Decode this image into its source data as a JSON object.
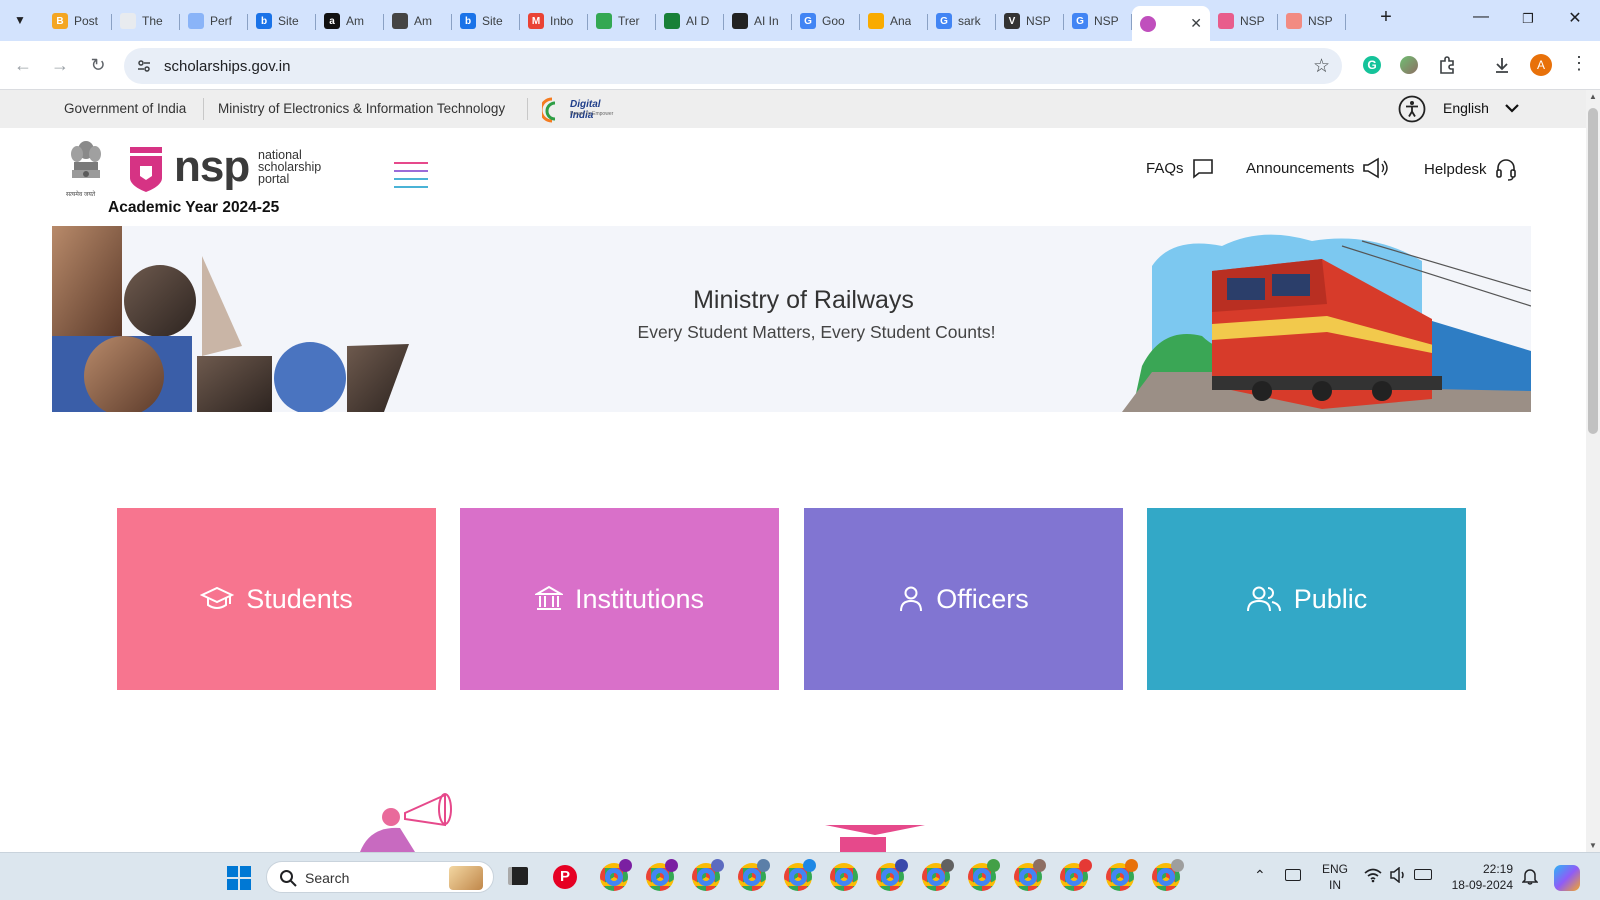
{
  "browser": {
    "tabs": [
      {
        "title": "Post",
        "color": "#f4a623",
        "glyph": "B"
      },
      {
        "title": "The",
        "color": "#e8ebef",
        "glyph": ""
      },
      {
        "title": "Perf",
        "color": "#8ab4f8",
        "glyph": ""
      },
      {
        "title": "Site",
        "color": "#1a73e8",
        "glyph": "b"
      },
      {
        "title": "Am",
        "color": "#111111",
        "glyph": "a"
      },
      {
        "title": "Am",
        "color": "#444444",
        "glyph": ""
      },
      {
        "title": "Site",
        "color": "#1a73e8",
        "glyph": "b"
      },
      {
        "title": "Inbo",
        "color": "#ea4335",
        "glyph": "M"
      },
      {
        "title": "Trer",
        "color": "#34a853",
        "glyph": ""
      },
      {
        "title": "AI D",
        "color": "#188038",
        "glyph": ""
      },
      {
        "title": "AI In",
        "color": "#222222",
        "glyph": ""
      },
      {
        "title": "Goo",
        "color": "#4285f4",
        "glyph": "G"
      },
      {
        "title": "Ana",
        "color": "#f9ab00",
        "glyph": ""
      },
      {
        "title": "sark",
        "color": "#4285f4",
        "glyph": "G"
      },
      {
        "title": "NSP",
        "color": "#333333",
        "glyph": "V"
      },
      {
        "title": "NSP",
        "color": "#4285f4",
        "glyph": "G"
      },
      {
        "title": "",
        "color": "#c04fbd",
        "glyph": "",
        "active": true
      },
      {
        "title": "NSP",
        "color": "#e85d8c",
        "glyph": ""
      },
      {
        "title": "NSP",
        "color": "#f28b82",
        "glyph": ""
      }
    ],
    "url": "scholarships.gov.in",
    "profile_initial": "A"
  },
  "gov_bar": {
    "gov_india": "Government of India",
    "ministry": "Ministry of Electronics & Information Technology",
    "digital_india": "Digital India",
    "digital_india_tag": "Power To Empower",
    "language": "English"
  },
  "header": {
    "logo_text": "nsp",
    "logo_lines": [
      "national",
      "scholarship",
      "portal"
    ],
    "academic_year": "Academic Year 2024-25",
    "emblem_caption": "सत्यमेव जयते",
    "nav": {
      "faqs": "FAQs",
      "announcements": "Announcements",
      "helpdesk": "Helpdesk"
    }
  },
  "banner": {
    "title": "Ministry of Railways",
    "subtitle": "Every Student Matters, Every Student Counts!"
  },
  "tiles": [
    {
      "label": "Students",
      "color": "#f7758f"
    },
    {
      "label": "Institutions",
      "color": "#d970c9"
    },
    {
      "label": "Officers",
      "color": "#8175d2"
    },
    {
      "label": "Public",
      "color": "#33a8c7"
    }
  ],
  "taskbar": {
    "search_placeholder": "Search",
    "lang_line1": "ENG",
    "lang_line2": "IN",
    "time": "22:19",
    "date": "18-09-2024"
  }
}
